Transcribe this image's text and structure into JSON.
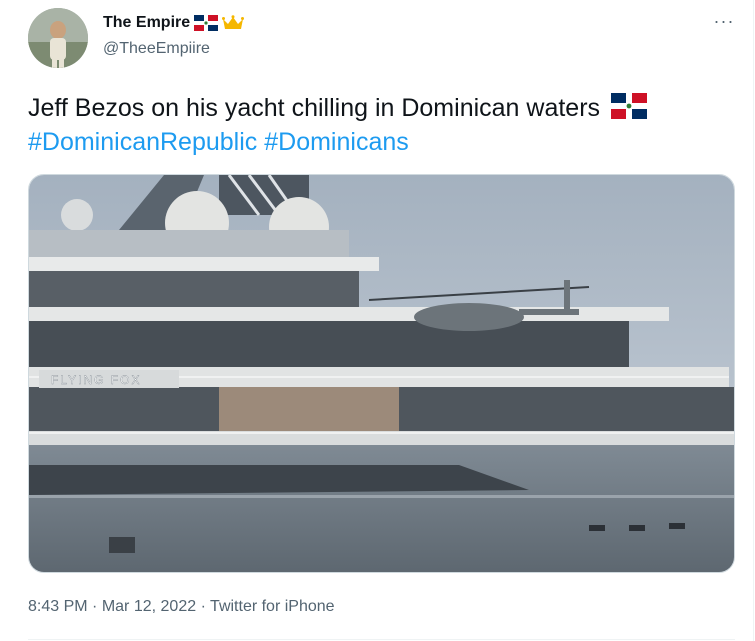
{
  "user": {
    "display_name": "The Empire",
    "handle": "@TheeEmpiire",
    "avatar_icon": "profile-photo",
    "badges": [
      "dominican-flag-icon",
      "crown-icon"
    ]
  },
  "tweet": {
    "text": "Jeff Bezos on his yacht chilling in Dominican waters",
    "text_emoji": "dominican-flag-icon",
    "hashtags": [
      "#DominicanRepublic",
      "#Dominicans"
    ],
    "media": {
      "type": "photo",
      "yacht_name": "FLYING FOX"
    }
  },
  "meta": {
    "time": "8:43 PM",
    "separator": "·",
    "date": "Mar 12, 2022",
    "source": "Twitter for iPhone"
  },
  "more_label": "···",
  "colors": {
    "link": "#1d9bf0",
    "secondary": "#536471",
    "text": "#0f1419"
  }
}
